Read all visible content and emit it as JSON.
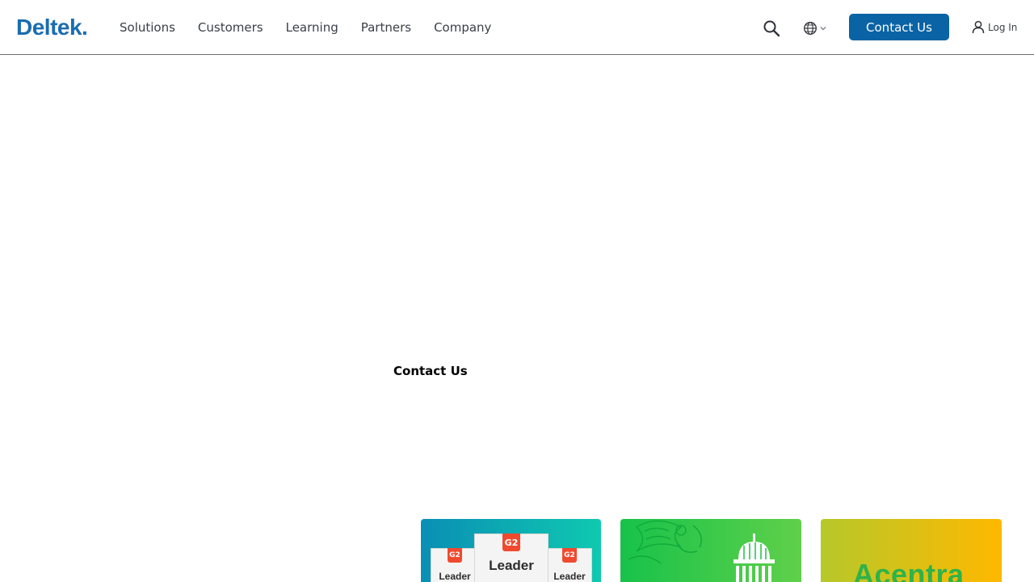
{
  "header": {
    "logo": "Deltek",
    "nav": [
      "Solutions",
      "Customers",
      "Learning",
      "Partners",
      "Company"
    ],
    "contact_label": "Contact Us",
    "login_label": "Log In",
    "icons": {
      "search": "search-icon",
      "language": "globe-icon",
      "user": "user-icon"
    }
  },
  "main": {
    "heading": "Contact Us"
  },
  "cards": {
    "card1": {
      "badge_left": "Leader",
      "badge_mid": "Leader",
      "badge_right": "Leader",
      "g2_mark": "G2"
    },
    "card3": {
      "wordmark": "Acentra"
    }
  },
  "colors": {
    "brand": "#1a6db0",
    "primary_button": "#0a63a5"
  }
}
